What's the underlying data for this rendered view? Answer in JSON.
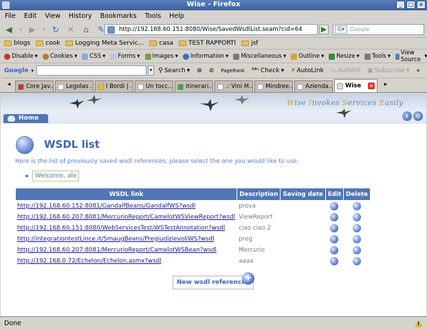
{
  "window": {
    "title": "Wise - Firefox"
  },
  "menu": [
    "File",
    "Edit",
    "View",
    "History",
    "Bookmarks",
    "Tools",
    "Help"
  ],
  "nav": {
    "url": "http://192.168.60.151:8080/Wise/SavedWsdlList.seam?cid=64",
    "search_placeholder": "Google"
  },
  "bookmarks": [
    "blogs",
    "cook",
    "Logging Meta Servic...",
    "casa",
    "TEST RAPPORTI",
    "jsf"
  ],
  "devbar": [
    "Disable",
    "Cookies",
    "CSS",
    "Forms",
    "Images",
    "Information",
    "Miscellaneous",
    "Outline",
    "Resize",
    "Tools",
    "View Source"
  ],
  "google_toolbar": {
    "logo": "Google",
    "items": [
      "Search",
      "Check",
      "AutoLink",
      "AutoFill",
      "Subscribe"
    ]
  },
  "tabs": [
    {
      "label": "Core Jav...",
      "color": "#c0392b"
    },
    {
      "label": "Legolas ...",
      "color": "#ffffff"
    },
    {
      "label": "I Bordi | ...",
      "color": "#e8c031"
    },
    {
      "label": "Un tocc...",
      "color": "#ffffff"
    },
    {
      "label": "itinerari...",
      "color": "#4a9c4a"
    },
    {
      "label": ".: Vini M...",
      "color": "#ffffff"
    },
    {
      "label": "Mindree...",
      "color": "#ffffff"
    },
    {
      "label": "Azienda...",
      "color": "#ffffff"
    },
    {
      "label": "Wise",
      "color": "#dddddd",
      "active": true
    }
  ],
  "header": {
    "slogan": [
      "W",
      "ise ",
      "I",
      "nvokes ",
      "S",
      "ervices ",
      "E",
      "asily"
    ],
    "home_label": "Home"
  },
  "page": {
    "title": "WSDL list",
    "intro": "Here is the list of previously saved wsdl references; please select the one you would like to use.",
    "welcome": "Welcome, ale",
    "columns": [
      "WSDL link",
      "Description",
      "Saving date",
      "Edit",
      "Delete"
    ],
    "rows": [
      {
        "link": "http://192.168.60.152:8081/GandalfBeans/GandalfWS?wsdl",
        "desc": "prova",
        "date": ""
      },
      {
        "link": "http://192.168.60.207:8081/MercurioReport/CamelotWSViewReport?wsdl",
        "desc": "ViewReport",
        "date": ""
      },
      {
        "link": "http://192.168.60.151:8080/WebServicesTest/WSTestAnnotation?wsdl",
        "desc": "ciao ciao 2",
        "date": ""
      },
      {
        "link": "http://integrationtestLince.it/SmaugBeans/PregiudizievoliWS?wsdl",
        "desc": "preg",
        "date": ""
      },
      {
        "link": "http://192.168.60.207:8081/MercurioReport/CamelotWSBean?wsdl",
        "desc": "Mercurio",
        "date": ""
      },
      {
        "link": "http://192.168.0.72/Echelon/Echelon.asmx?wsdl",
        "desc": "aaaa",
        "date": ""
      }
    ],
    "new_button": "New wsdl reference"
  },
  "status": {
    "text": "Done"
  }
}
